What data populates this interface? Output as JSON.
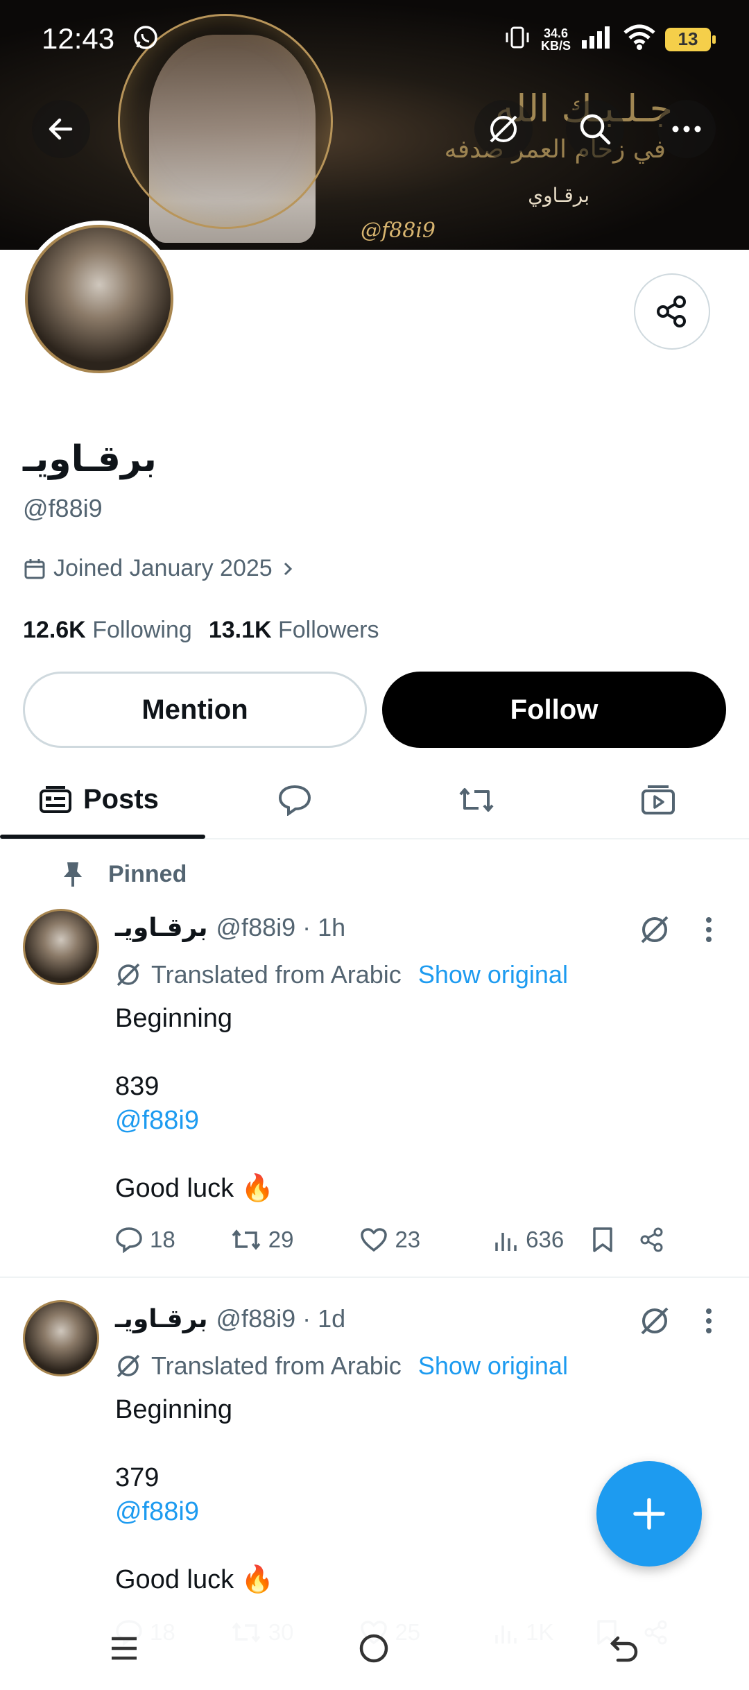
{
  "status_bar": {
    "time": "12:43",
    "speed_top": "34.6",
    "speed_bottom": "KB/S",
    "battery": "13"
  },
  "banner": {
    "arabic_line1": "جـلـبـك الله",
    "arabic_line2": "في زحام العمر صدفه",
    "arabic_sig": "برقـاوي",
    "watermark": "@f88i9"
  },
  "profile": {
    "display_name": "برقـاويـ",
    "handle": "@f88i9",
    "joined": "Joined January 2025",
    "following_count": "12.6K",
    "following_label": "Following",
    "followers_count": "13.1K",
    "followers_label": "Followers",
    "mention_label": "Mention",
    "follow_label": "Follow"
  },
  "tabs": [
    {
      "label": "Posts",
      "icon": "posts-icon"
    },
    {
      "label": "",
      "icon": "replies-icon"
    },
    {
      "label": "",
      "icon": "reposts-icon"
    },
    {
      "label": "",
      "icon": "media-icon"
    }
  ],
  "pinned_label": "Pinned",
  "posts": [
    {
      "name": "برقـاويـ",
      "meta": "@f88i9 · 1h",
      "translated": "Translated from Arabic",
      "show_original": "Show original",
      "line1": "Beginning",
      "line2": "839",
      "mention": "@f88i9",
      "line3": "Good luck 🔥",
      "replies": "18",
      "reposts": "29",
      "likes": "23",
      "views": "636"
    },
    {
      "name": "برقـاويـ",
      "meta": "@f88i9 · 1d",
      "translated": "Translated from Arabic",
      "show_original": "Show original",
      "line1": "Beginning",
      "line2": "379",
      "mention": "@f88i9",
      "line3": "Good luck 🔥",
      "replies": "18",
      "reposts": "30",
      "likes": "25",
      "views": "1K"
    }
  ],
  "colors": {
    "accent": "#1d9bf0",
    "text": "#0f1419",
    "secondary": "#536471",
    "border": "#cfd9de"
  }
}
